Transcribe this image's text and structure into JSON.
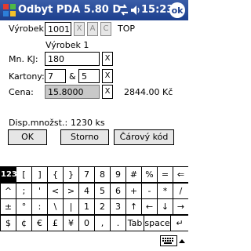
{
  "titlebar": {
    "title": "Odbyt PDA 5.80 D",
    "clock": "15:23",
    "ok_label": "ok"
  },
  "form": {
    "vyrobek_label": "Výrobek:",
    "vyrobek_value": "1001",
    "btn_x": "X",
    "btn_a": "A",
    "btn_c": "C",
    "top_label": "TOP",
    "vyrobek_name": "Výrobek 1",
    "mnkj_label": "Mn. KJ:",
    "mnkj_value": "180",
    "kartony_label": "Kartony:",
    "kartony_value1": "7",
    "ampersand": "&",
    "kartony_value2": "5",
    "cena_label": "Cena:",
    "cena_value": "15.8000",
    "cena_total": "2844.00 Kč",
    "disp_label": "Disp.množst.:",
    "disp_value": "1230 ks"
  },
  "buttons": {
    "ok": "OK",
    "storno": "Storno",
    "barcode": "Čárový kód"
  },
  "keyboard": {
    "rows": [
      [
        "123",
        "[",
        "]",
        "{",
        "}",
        "7",
        "8",
        "9",
        "#",
        "%",
        "=",
        "⇐"
      ],
      [
        "^",
        ";",
        "'",
        "<",
        ">",
        "4",
        "5",
        "6",
        "+",
        "-",
        "*",
        "/"
      ],
      [
        "±",
        "°",
        ":",
        "\\",
        "|",
        "1",
        "2",
        "3",
        "↑",
        "←",
        "↓",
        "→"
      ],
      [
        "$",
        "¢",
        "€",
        "£",
        "¥",
        "0",
        ",",
        ".",
        "Tab",
        "space",
        "↵"
      ]
    ]
  },
  "bottombar": {
    "keyboard_icon": "keyboard-icon"
  }
}
